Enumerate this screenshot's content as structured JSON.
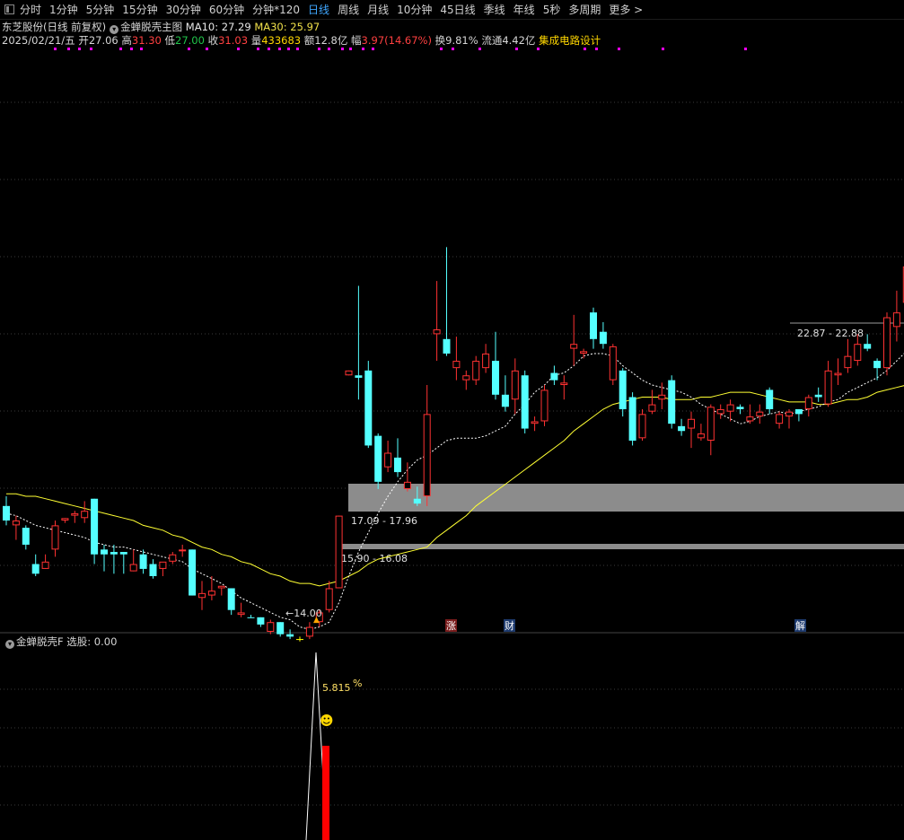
{
  "toolbar": {
    "periods": [
      {
        "label": "分时",
        "active": false
      },
      {
        "label": "1分钟",
        "active": false
      },
      {
        "label": "5分钟",
        "active": false
      },
      {
        "label": "15分钟",
        "active": false
      },
      {
        "label": "30分钟",
        "active": false
      },
      {
        "label": "60分钟",
        "active": false
      },
      {
        "label": "分钟*120",
        "active": false
      },
      {
        "label": "日线",
        "active": true
      },
      {
        "label": "周线",
        "active": false
      },
      {
        "label": "月线",
        "active": false
      },
      {
        "label": "10分钟",
        "active": false
      },
      {
        "label": "45日线",
        "active": false
      },
      {
        "label": "季线",
        "active": false
      },
      {
        "label": "年线",
        "active": false
      },
      {
        "label": "5秒",
        "active": false
      },
      {
        "label": "多周期",
        "active": false
      },
      {
        "label": "更多 >",
        "active": false
      }
    ]
  },
  "header": {
    "stock": "东芝股份(日线 前复权)",
    "indicator": "金蝉脱壳主图",
    "ma10_label": "MA10: 27.29",
    "ma30_label": "MA30: 25.97"
  },
  "quote": {
    "date": "2025/02/21/五",
    "open_label": "开",
    "open": "27.06",
    "high_label": "高",
    "high": "31.30",
    "low_label": "低",
    "low": "27.00",
    "close_label": "收",
    "close": "31.03",
    "volume_label": "量",
    "volume": "433683",
    "amount_label": "额",
    "amount": "12.8亿",
    "change_label": "幅",
    "change": "3.97(14.67%)",
    "turnover_label": "换",
    "turnover": "9.81%",
    "float_label": "流通",
    "float": "4.42亿",
    "sector": "集成电路设计"
  },
  "sub_panel": {
    "title": "金蝉脱壳F",
    "value": "选股: 0.00"
  },
  "colors": {
    "up": "#ff3232",
    "down": "#54ffff",
    "ma10": "#ffffff",
    "ma30": "#ffff33",
    "zone": "#8c8c8c",
    "signal": "#ffff00",
    "marker": "#ff00ff",
    "grid": "#3a3a3a",
    "sub_bar": "#ff0000"
  },
  "chart_data": {
    "type": "candlestick",
    "y_range": [
      13.4,
      37.4
    ],
    "candles": [
      {
        "o": 18.6,
        "h": 19.0,
        "l": 17.8,
        "c": 18.0,
        "t": "down"
      },
      {
        "o": 17.8,
        "h": 18.2,
        "l": 17.2,
        "c": 18.0,
        "t": "up"
      },
      {
        "o": 17.7,
        "h": 17.8,
        "l": 16.8,
        "c": 17.0,
        "t": "down"
      },
      {
        "o": 16.2,
        "h": 16.6,
        "l": 15.7,
        "c": 15.8,
        "t": "down"
      },
      {
        "o": 16.0,
        "h": 16.6,
        "l": 16.0,
        "c": 16.3,
        "t": "up"
      },
      {
        "o": 16.8,
        "h": 18.0,
        "l": 16.5,
        "c": 17.8,
        "t": "up"
      },
      {
        "o": 18.1,
        "h": 18.1,
        "l": 17.9,
        "c": 18.0,
        "t": "up"
      },
      {
        "o": 18.2,
        "h": 18.4,
        "l": 17.9,
        "c": 18.3,
        "t": "up"
      },
      {
        "o": 18.4,
        "h": 18.8,
        "l": 17.9,
        "c": 18.1,
        "t": "up"
      },
      {
        "o": 18.9,
        "h": 18.9,
        "l": 16.2,
        "c": 16.6,
        "t": "down"
      },
      {
        "o": 16.8,
        "h": 17.0,
        "l": 15.9,
        "c": 16.6,
        "t": "down"
      },
      {
        "o": 16.7,
        "h": 17.0,
        "l": 15.8,
        "c": 16.6,
        "t": "down"
      },
      {
        "o": 16.7,
        "h": 16.7,
        "l": 15.8,
        "c": 16.6,
        "t": "down"
      },
      {
        "o": 16.2,
        "h": 16.8,
        "l": 15.9,
        "c": 15.9,
        "t": "up"
      },
      {
        "o": 16.6,
        "h": 16.8,
        "l": 15.8,
        "c": 16.0,
        "t": "down"
      },
      {
        "o": 16.2,
        "h": 16.4,
        "l": 15.6,
        "c": 15.7,
        "t": "down"
      },
      {
        "o": 16.0,
        "h": 16.2,
        "l": 15.7,
        "c": 16.3,
        "t": "up"
      },
      {
        "o": 16.6,
        "h": 16.7,
        "l": 16.2,
        "c": 16.3,
        "t": "up"
      },
      {
        "o": 16.8,
        "h": 17.0,
        "l": 16.5,
        "c": 16.8,
        "t": "up"
      },
      {
        "o": 16.8,
        "h": 16.8,
        "l": 14.9,
        "c": 14.9,
        "t": "down"
      },
      {
        "o": 15.0,
        "h": 15.5,
        "l": 14.3,
        "c": 14.8,
        "t": "up"
      },
      {
        "o": 14.9,
        "h": 15.7,
        "l": 14.7,
        "c": 15.1,
        "t": "up"
      },
      {
        "o": 15.2,
        "h": 15.3,
        "l": 14.9,
        "c": 15.3,
        "t": "up"
      },
      {
        "o": 15.2,
        "h": 15.2,
        "l": 14.1,
        "c": 14.3,
        "t": "down"
      },
      {
        "o": 14.2,
        "h": 14.6,
        "l": 14.0,
        "c": 14.1,
        "t": "up"
      },
      {
        "o": 14.0,
        "h": 14.1,
        "l": 14.0,
        "c": 14.0,
        "t": "down"
      },
      {
        "o": 14.0,
        "h": 14.0,
        "l": 13.6,
        "c": 13.7,
        "t": "down"
      },
      {
        "o": 13.4,
        "h": 13.9,
        "l": 13.3,
        "c": 13.8,
        "t": "up"
      },
      {
        "o": 13.8,
        "h": 13.8,
        "l": 13.2,
        "c": 13.3,
        "t": "down"
      },
      {
        "o": 13.3,
        "h": 13.5,
        "l": 13.1,
        "c": 13.2,
        "t": "down"
      },
      {
        "o": 13.1,
        "h": 13.2,
        "l": 13.0,
        "c": 13.1,
        "t": "signal"
      },
      {
        "o": 13.2,
        "h": 13.8,
        "l": 13.1,
        "c": 13.6,
        "t": "up"
      },
      {
        "o": 13.8,
        "h": 14.3,
        "l": 13.6,
        "c": 14.2,
        "t": "up"
      },
      {
        "o": 14.3,
        "h": 15.5,
        "l": 14.2,
        "c": 15.2,
        "t": "up"
      },
      {
        "o": 15.2,
        "h": 18.2,
        "l": 15.2,
        "c": 18.2,
        "t": "up"
      },
      {
        "o": 24.2,
        "h": 24.2,
        "l": 24.0,
        "c": 24.0,
        "t": "up"
      },
      {
        "o": 24.0,
        "h": 27.7,
        "l": 23.0,
        "c": 23.9,
        "t": "down"
      },
      {
        "o": 24.2,
        "h": 24.6,
        "l": 21.0,
        "c": 21.1,
        "t": "down"
      },
      {
        "o": 21.5,
        "h": 21.6,
        "l": 19.3,
        "c": 19.6,
        "t": "down"
      },
      {
        "o": 20.8,
        "h": 21.3,
        "l": 20.0,
        "c": 20.2,
        "t": "up"
      },
      {
        "o": 20.6,
        "h": 21.4,
        "l": 19.8,
        "c": 20.0,
        "t": "down"
      },
      {
        "o": 19.3,
        "h": 20.4,
        "l": 19.2,
        "c": 19.6,
        "t": "up"
      },
      {
        "o": 18.7,
        "h": 19.4,
        "l": 18.6,
        "c": 18.9,
        "t": "down"
      },
      {
        "o": 19.0,
        "h": 23.6,
        "l": 18.6,
        "c": 22.4,
        "t": "up"
      },
      {
        "o": 25.9,
        "h": 27.9,
        "l": 24.6,
        "c": 25.7,
        "t": "up"
      },
      {
        "o": 25.5,
        "h": 29.3,
        "l": 24.8,
        "c": 24.9,
        "t": "down"
      },
      {
        "o": 24.6,
        "h": 25.6,
        "l": 23.8,
        "c": 24.3,
        "t": "up"
      },
      {
        "o": 24.0,
        "h": 24.2,
        "l": 23.4,
        "c": 23.8,
        "t": "up"
      },
      {
        "o": 23.8,
        "h": 24.8,
        "l": 23.6,
        "c": 24.6,
        "t": "up"
      },
      {
        "o": 24.9,
        "h": 25.3,
        "l": 24.1,
        "c": 24.3,
        "t": "up"
      },
      {
        "o": 24.6,
        "h": 25.8,
        "l": 23.0,
        "c": 23.2,
        "t": "down"
      },
      {
        "o": 23.2,
        "h": 24.0,
        "l": 22.5,
        "c": 22.7,
        "t": "down"
      },
      {
        "o": 23.0,
        "h": 24.7,
        "l": 22.4,
        "c": 24.2,
        "t": "up"
      },
      {
        "o": 24.0,
        "h": 24.2,
        "l": 21.6,
        "c": 21.8,
        "t": "down"
      },
      {
        "o": 22.1,
        "h": 22.3,
        "l": 21.7,
        "c": 22.0,
        "t": "up"
      },
      {
        "o": 22.1,
        "h": 23.6,
        "l": 21.9,
        "c": 23.4,
        "t": "up"
      },
      {
        "o": 24.1,
        "h": 24.4,
        "l": 23.6,
        "c": 23.8,
        "t": "down"
      },
      {
        "o": 23.7,
        "h": 24.0,
        "l": 23.0,
        "c": 23.6,
        "t": "up"
      },
      {
        "o": 25.1,
        "h": 26.5,
        "l": 24.4,
        "c": 25.3,
        "t": "up"
      },
      {
        "o": 24.9,
        "h": 25.1,
        "l": 24.7,
        "c": 25.0,
        "t": "up"
      },
      {
        "o": 26.6,
        "h": 26.8,
        "l": 25.1,
        "c": 25.5,
        "t": "down"
      },
      {
        "o": 25.8,
        "h": 26.2,
        "l": 25.1,
        "c": 25.3,
        "t": "down"
      },
      {
        "o": 25.2,
        "h": 25.3,
        "l": 23.6,
        "c": 23.8,
        "t": "up"
      },
      {
        "o": 24.2,
        "h": 24.3,
        "l": 22.3,
        "c": 22.6,
        "t": "down"
      },
      {
        "o": 23.1,
        "h": 23.3,
        "l": 21.1,
        "c": 21.3,
        "t": "down"
      },
      {
        "o": 21.4,
        "h": 22.6,
        "l": 21.3,
        "c": 22.4,
        "t": "up"
      },
      {
        "o": 22.5,
        "h": 23.4,
        "l": 22.4,
        "c": 22.8,
        "t": "up"
      },
      {
        "o": 23.0,
        "h": 23.7,
        "l": 22.6,
        "c": 23.2,
        "t": "up"
      },
      {
        "o": 23.8,
        "h": 24.0,
        "l": 21.8,
        "c": 22.0,
        "t": "down"
      },
      {
        "o": 21.9,
        "h": 22.2,
        "l": 21.5,
        "c": 21.7,
        "t": "down"
      },
      {
        "o": 21.8,
        "h": 22.5,
        "l": 21.0,
        "c": 22.2,
        "t": "up"
      },
      {
        "o": 21.6,
        "h": 22.0,
        "l": 21.3,
        "c": 21.4,
        "t": "up"
      },
      {
        "o": 21.3,
        "h": 22.8,
        "l": 20.7,
        "c": 22.7,
        "t": "up"
      },
      {
        "o": 22.4,
        "h": 22.8,
        "l": 22.2,
        "c": 22.6,
        "t": "up"
      },
      {
        "o": 22.5,
        "h": 23.0,
        "l": 22.1,
        "c": 22.8,
        "t": "up"
      },
      {
        "o": 22.6,
        "h": 22.8,
        "l": 22.4,
        "c": 22.7,
        "t": "down"
      },
      {
        "o": 22.3,
        "h": 22.8,
        "l": 22.0,
        "c": 22.1,
        "t": "up"
      },
      {
        "o": 22.5,
        "h": 22.8,
        "l": 22.0,
        "c": 22.3,
        "t": "up"
      },
      {
        "o": 23.4,
        "h": 23.5,
        "l": 22.4,
        "c": 22.6,
        "t": "down"
      },
      {
        "o": 22.4,
        "h": 22.5,
        "l": 21.8,
        "c": 22.0,
        "t": "up"
      },
      {
        "o": 22.3,
        "h": 22.6,
        "l": 21.8,
        "c": 22.5,
        "t": "up"
      },
      {
        "o": 22.4,
        "h": 22.6,
        "l": 22.1,
        "c": 22.6,
        "t": "down"
      },
      {
        "o": 22.6,
        "h": 23.2,
        "l": 22.3,
        "c": 23.1,
        "t": "up"
      },
      {
        "o": 23.2,
        "h": 23.5,
        "l": 22.9,
        "c": 23.1,
        "t": "down"
      },
      {
        "o": 22.8,
        "h": 24.6,
        "l": 22.7,
        "c": 24.2,
        "t": "up"
      },
      {
        "o": 24.1,
        "h": 24.7,
        "l": 23.6,
        "c": 24.0,
        "t": "up"
      },
      {
        "o": 24.8,
        "h": 25.5,
        "l": 24.1,
        "c": 24.3,
        "t": "up"
      },
      {
        "o": 24.6,
        "h": 25.7,
        "l": 24.4,
        "c": 25.3,
        "t": "up"
      },
      {
        "o": 25.3,
        "h": 25.7,
        "l": 25.0,
        "c": 25.1,
        "t": "down"
      },
      {
        "o": 24.6,
        "h": 24.7,
        "l": 23.8,
        "c": 24.3,
        "t": "down"
      },
      {
        "o": 24.3,
        "h": 26.6,
        "l": 24.0,
        "c": 26.4,
        "t": "up"
      },
      {
        "o": 26.6,
        "h": 27.5,
        "l": 25.4,
        "c": 26.0,
        "t": "up"
      },
      {
        "o": 27.0,
        "h": 29.4,
        "l": 25.8,
        "c": 28.5,
        "t": "up"
      },
      {
        "o": 28.7,
        "h": 29.8,
        "l": 27.1,
        "c": 27.5,
        "t": "down"
      },
      {
        "o": 27.1,
        "h": 27.6,
        "l": 25.8,
        "c": 27.4,
        "t": "up"
      }
    ],
    "ma10": [
      18.3,
      18.2,
      18.0,
      17.8,
      17.7,
      17.6,
      17.5,
      17.4,
      17.3,
      17.1,
      17.0,
      16.9,
      16.9,
      16.8,
      16.7,
      16.6,
      16.5,
      16.4,
      16.3,
      16.0,
      15.8,
      15.6,
      15.4,
      15.1,
      14.8,
      14.6,
      14.4,
      14.2,
      14.0,
      13.9,
      13.6,
      13.5,
      13.6,
      13.8,
      14.6,
      15.7,
      16.7,
      17.5,
      18.3,
      19.0,
      19.6,
      20.1,
      20.5,
      20.7,
      21.0,
      21.3,
      21.4,
      21.4,
      21.4,
      21.5,
      21.7,
      21.9,
      22.4,
      22.8,
      23.3,
      23.6,
      24.0,
      24.1,
      24.4,
      24.8,
      24.9,
      24.9,
      24.8,
      24.4,
      24.1,
      23.8,
      23.6,
      23.5,
      23.4,
      23.3,
      23.1,
      22.8,
      22.6,
      22.4,
      22.2,
      22.0,
      22.1,
      22.3,
      22.4,
      22.5,
      22.4,
      22.5,
      22.6,
      22.7,
      22.9,
      23.0,
      23.3,
      23.5,
      23.7,
      23.9,
      24.2,
      24.6,
      25.0,
      25.4,
      25.6
    ],
    "ma30": [
      19.1,
      19.1,
      19.0,
      19.0,
      18.9,
      18.8,
      18.7,
      18.6,
      18.5,
      18.4,
      18.3,
      18.2,
      18.1,
      18.0,
      17.8,
      17.7,
      17.6,
      17.4,
      17.3,
      17.1,
      16.9,
      16.8,
      16.6,
      16.5,
      16.3,
      16.2,
      16.0,
      15.8,
      15.7,
      15.5,
      15.4,
      15.4,
      15.3,
      15.4,
      15.5,
      15.7,
      15.9,
      16.2,
      16.4,
      16.5,
      16.6,
      16.7,
      16.8,
      16.9,
      17.3,
      17.6,
      17.9,
      18.2,
      18.6,
      18.9,
      19.2,
      19.5,
      19.8,
      20.1,
      20.4,
      20.7,
      21.0,
      21.3,
      21.7,
      22.0,
      22.3,
      22.6,
      22.8,
      22.9,
      23.0,
      23.1,
      23.1,
      23.1,
      23.0,
      23.0,
      23.0,
      23.1,
      23.1,
      23.2,
      23.3,
      23.3,
      23.3,
      23.2,
      23.1,
      23.0,
      22.9,
      22.9,
      22.9,
      22.8,
      22.8,
      22.9,
      23.0,
      23.0,
      23.1,
      23.3,
      23.4,
      23.5,
      23.6,
      23.6,
      23.6
    ],
    "zones": [
      {
        "lo": 17.09,
        "hi": 17.96,
        "label": "17.09 - 17.96"
      },
      {
        "lo": 15.9,
        "hi": 16.08,
        "label": "15.90 - 16.08"
      },
      {
        "lo": 22.87,
        "hi": 22.88,
        "label": "22.87 - 22.88"
      }
    ],
    "low_marker": {
      "label": "←14.00"
    },
    "events": [
      {
        "label": "涨",
        "bg": "#7a1c1c"
      },
      {
        "label": "财",
        "bg": "#1d3a6e"
      },
      {
        "label": "解",
        "bg": "#1d3a6e"
      }
    ],
    "sub_chart": {
      "label": "5.815",
      "unit": "%",
      "smiley": "☻"
    }
  }
}
